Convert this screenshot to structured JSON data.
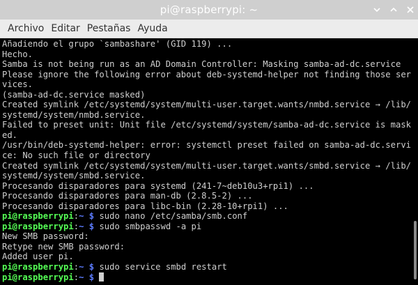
{
  "window": {
    "title": "pi@raspberrypi: ~"
  },
  "menu": {
    "items": [
      "Archivo",
      "Editar",
      "Pestañas",
      "Ayuda"
    ]
  },
  "colors": {
    "prompt_user": "#55ff55",
    "prompt_path": "#5c7cff",
    "text": "#cfcfcf",
    "background": "#000000"
  },
  "terminal": {
    "lines": [
      {
        "type": "out",
        "text": "Añadiendo el grupo `sambashare' (GID 119) ..."
      },
      {
        "type": "out",
        "text": "Hecho."
      },
      {
        "type": "out",
        "text": "Samba is not being run as an AD Domain Controller: Masking samba-ad-dc.service"
      },
      {
        "type": "out",
        "text": "Please ignore the following error about deb-systemd-helper not finding those ser"
      },
      {
        "type": "out",
        "text": "vices."
      },
      {
        "type": "out",
        "text": "(samba-ad-dc.service masked)"
      },
      {
        "type": "out",
        "text": "Created symlink /etc/systemd/system/multi-user.target.wants/nmbd.service → /lib/"
      },
      {
        "type": "out",
        "text": "systemd/system/nmbd.service."
      },
      {
        "type": "out",
        "text": "Failed to preset unit: Unit file /etc/systemd/system/samba-ad-dc.service is mask"
      },
      {
        "type": "out",
        "text": "ed."
      },
      {
        "type": "out",
        "text": "/usr/bin/deb-systemd-helper: error: systemctl preset failed on samba-ad-dc.servi"
      },
      {
        "type": "out",
        "text": "ce: No such file or directory"
      },
      {
        "type": "out",
        "text": "Created symlink /etc/systemd/system/multi-user.target.wants/smbd.service → /lib/"
      },
      {
        "type": "out",
        "text": "systemd/system/smbd.service."
      },
      {
        "type": "out",
        "text": "Procesando disparadores para systemd (241-7~deb10u3+rpi1) ..."
      },
      {
        "type": "out",
        "text": "Procesando disparadores para man-db (2.8.5-2) ..."
      },
      {
        "type": "out",
        "text": "Procesando disparadores para libc-bin (2.28-10+rpi1) ..."
      },
      {
        "type": "prompt",
        "user": "pi@raspberrypi",
        "path": "~",
        "cmd": "sudo nano /etc/samba/smb.conf"
      },
      {
        "type": "prompt",
        "user": "pi@raspberrypi",
        "path": "~",
        "cmd": "sudo smbpasswd -a pi"
      },
      {
        "type": "out",
        "text": "New SMB password:"
      },
      {
        "type": "out",
        "text": "Retype new SMB password:"
      },
      {
        "type": "out",
        "text": "Added user pi."
      },
      {
        "type": "prompt",
        "user": "pi@raspberrypi",
        "path": "~",
        "cmd": "sudo service smbd restart"
      },
      {
        "type": "prompt",
        "user": "pi@raspberrypi",
        "path": "~",
        "cmd": "",
        "cursor": true
      }
    ]
  }
}
